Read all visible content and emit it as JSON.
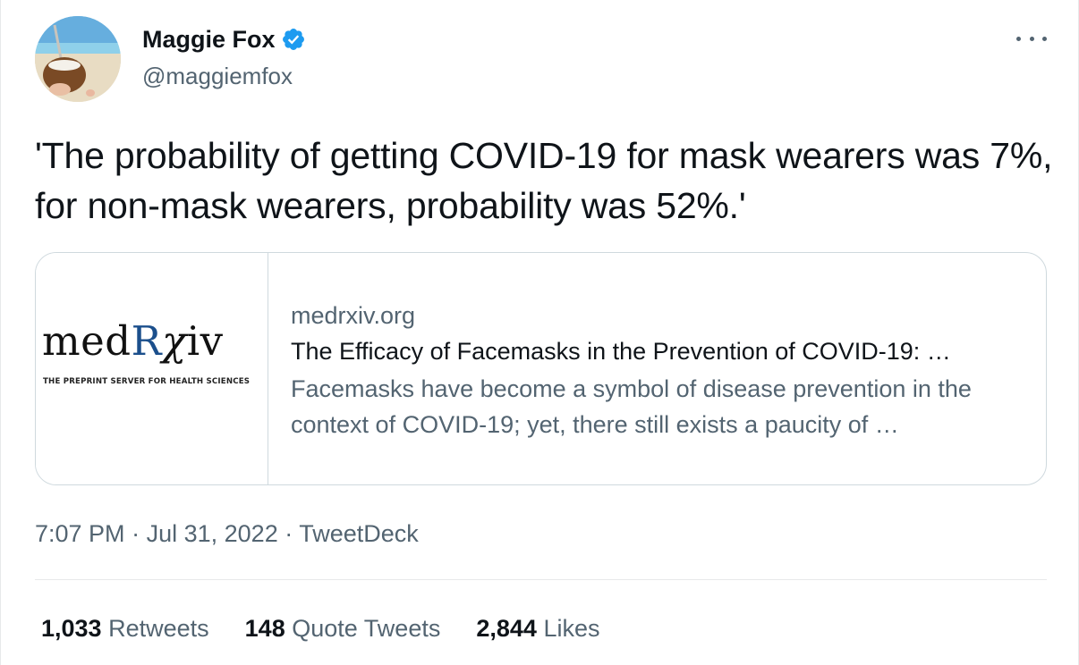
{
  "user": {
    "display_name": "Maggie Fox",
    "handle": "@maggiemfox",
    "verified": true,
    "verified_color": "#1d9bf0"
  },
  "tweet": {
    "text": "'The probability of getting COVID-19 for mask wearers was 7%, for non-mask wearers, probability was 52%.'"
  },
  "card": {
    "logo": {
      "part_med": "med",
      "part_r": "R",
      "part_chi": "χ",
      "part_iv": "iv",
      "tagline": "THE PREPRINT SERVER FOR HEALTH SCIENCES"
    },
    "domain": "medrxiv.org",
    "title": "The Efficacy of Facemasks in the Prevention of COVID-19: …",
    "description": "Facemasks have become a symbol of disease prevention in the context of COVID-19; yet, there still exists a paucity of …"
  },
  "meta": {
    "time": "7:07 PM",
    "separator": "·",
    "date": "Jul 31, 2022",
    "source": "TweetDeck"
  },
  "stats": {
    "retweets": {
      "count": "1,033",
      "label": "Retweets"
    },
    "quotes": {
      "count": "148",
      "label": "Quote Tweets"
    },
    "likes": {
      "count": "2,844",
      "label": "Likes"
    }
  },
  "icons": [
    "verified-icon",
    "more-icon"
  ],
  "colors": {
    "text": "#0f1419",
    "secondary": "#536471",
    "border": "#cfd9de",
    "logo_blue": "#1b4f8c"
  }
}
